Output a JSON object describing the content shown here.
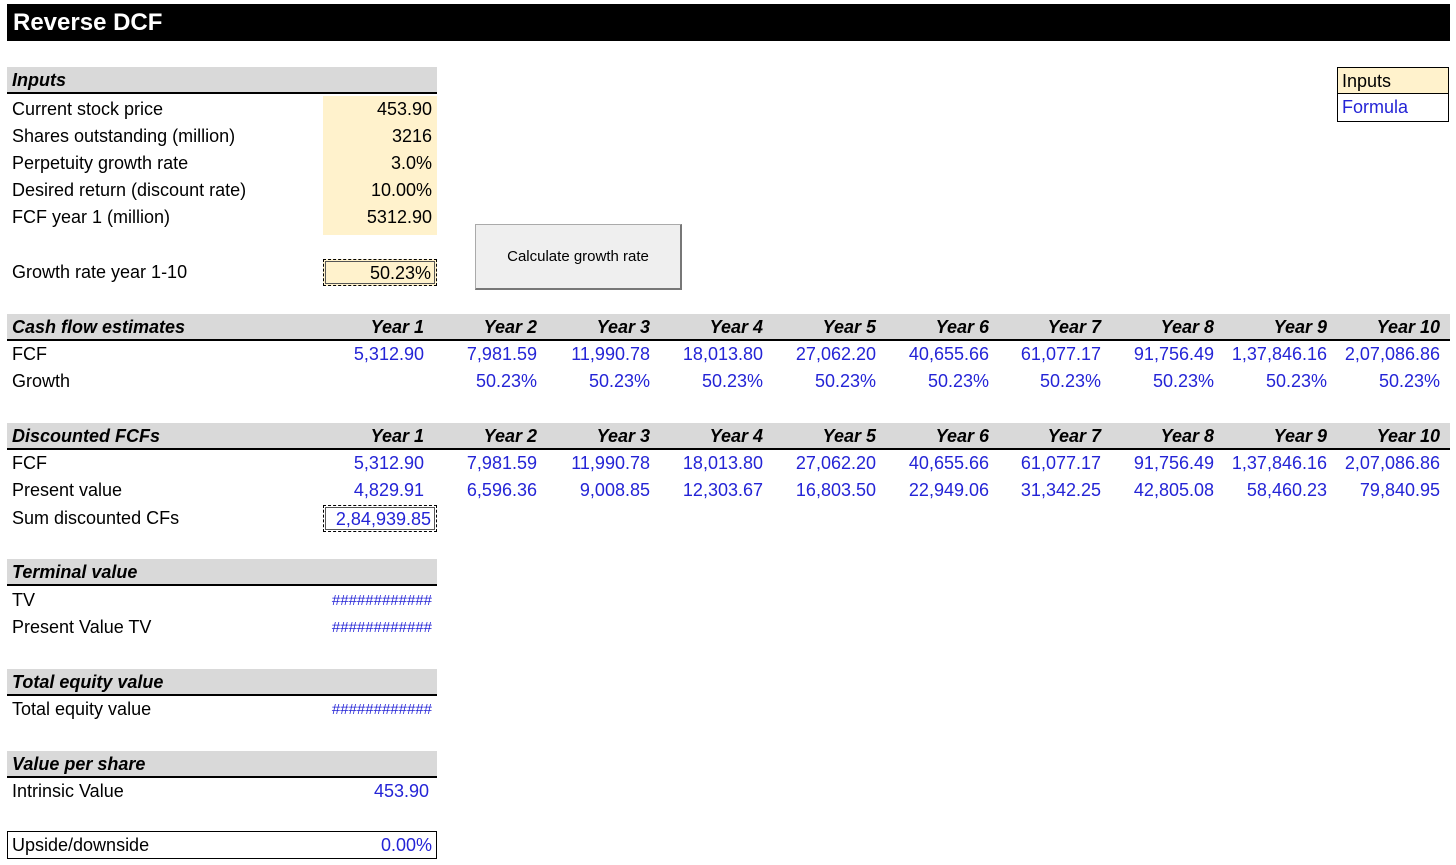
{
  "title": "Reverse DCF",
  "legend": {
    "inputs": "Inputs",
    "formula": "Formula"
  },
  "inputs": {
    "header": "Inputs",
    "rows": [
      {
        "label": "Current stock price",
        "value": "453.90"
      },
      {
        "label": "Shares outstanding (million)",
        "value": "3216"
      },
      {
        "label": "Perpetuity growth rate",
        "value": "3.0%"
      },
      {
        "label": "Desired return (discount rate)",
        "value": "10.00%"
      },
      {
        "label": "FCF year 1 (million)",
        "value": "5312.90"
      }
    ],
    "growth_label": "Growth rate year 1-10",
    "growth_value": "50.23%"
  },
  "button": {
    "label": "Calculate growth rate"
  },
  "years": [
    "Year 1",
    "Year 2",
    "Year 3",
    "Year 4",
    "Year 5",
    "Year 6",
    "Year 7",
    "Year 8",
    "Year 9",
    "Year 10"
  ],
  "cash_flow": {
    "header": "Cash flow estimates",
    "fcf_label": "FCF",
    "fcf": [
      "5,312.90",
      "7,981.59",
      "11,990.78",
      "18,013.80",
      "27,062.20",
      "40,655.66",
      "61,077.17",
      "91,756.49",
      "1,37,846.16",
      "2,07,086.86"
    ],
    "growth_label": "Growth",
    "growth": [
      "",
      "50.23%",
      "50.23%",
      "50.23%",
      "50.23%",
      "50.23%",
      "50.23%",
      "50.23%",
      "50.23%",
      "50.23%"
    ]
  },
  "discounted": {
    "header": "Discounted FCFs",
    "fcf_label": "FCF",
    "fcf": [
      "5,312.90",
      "7,981.59",
      "11,990.78",
      "18,013.80",
      "27,062.20",
      "40,655.66",
      "61,077.17",
      "91,756.49",
      "1,37,846.16",
      "2,07,086.86"
    ],
    "pv_label": "Present value",
    "pv": [
      "4,829.91",
      "6,596.36",
      "9,008.85",
      "12,303.67",
      "16,803.50",
      "22,949.06",
      "31,342.25",
      "42,805.08",
      "58,460.23",
      "79,840.95"
    ],
    "sum_label": "Sum discounted CFs",
    "sum_value": "2,84,939.85"
  },
  "terminal": {
    "header": "Terminal value",
    "tv_label": "TV",
    "tv_value": "############",
    "pv_label": "Present Value TV",
    "pv_value": "############"
  },
  "equity": {
    "header": "Total equity value",
    "label": "Total equity value",
    "value": "############"
  },
  "per_share": {
    "header": "Value per share",
    "label": "Intrinsic Value",
    "value": "453.90"
  },
  "upside": {
    "label": "Upside/downside",
    "value": "0.00%"
  },
  "colors": {
    "input_fill": "#fff2cc",
    "formula_text": "#2424d6",
    "header_fill": "#d9d9d9"
  }
}
